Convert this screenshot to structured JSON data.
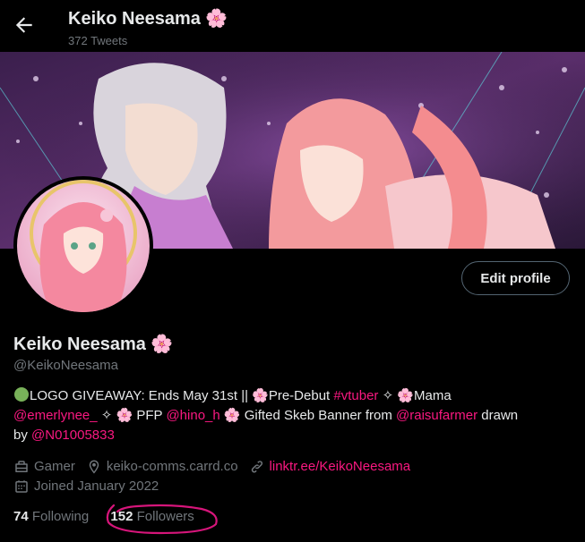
{
  "header": {
    "title": "Keiko Neesama 🌸",
    "tweet_count": "372 Tweets"
  },
  "profile": {
    "name": "Keiko Neesama 🌸",
    "handle": "@KeikoNeesama",
    "edit_button": "Edit profile"
  },
  "bio": {
    "l1_a": "LOGO GIVEAWAY: Ends May 31st || ",
    "l1_b": "Pre-Debut ",
    "l1_tag": "#vtuber",
    "l1_c": " ✧ ",
    "l1_d": "Mama",
    "l2_mention1": "@emerlynee_",
    "l2_a": " ✧ ",
    "l2_b": " PFP ",
    "l2_mention2": "@hino_h",
    "l2_c": " Gifted Skeb Banner from ",
    "l2_mention3": "@raisufarmer",
    "l2_d": " drawn",
    "l3_a": "by ",
    "l3_mention": "@N01005833",
    "blossom": "🌸"
  },
  "meta": {
    "category": "Gamer",
    "location": "keiko-comms.carrd.co",
    "website": "linktr.ee/KeikoNeesama",
    "joined": "Joined January 2022"
  },
  "stats": {
    "following_count": "74",
    "following_label": "Following",
    "followers_count": "152",
    "followers_label": "Followers"
  },
  "colors": {
    "accent": "#f91880",
    "muted": "#71767b",
    "annotation": "#d6157a"
  },
  "icons": {
    "back": "arrow-left-icon",
    "category": "briefcase-icon",
    "location": "location-pin-icon",
    "website": "link-icon",
    "joined": "calendar-icon"
  }
}
